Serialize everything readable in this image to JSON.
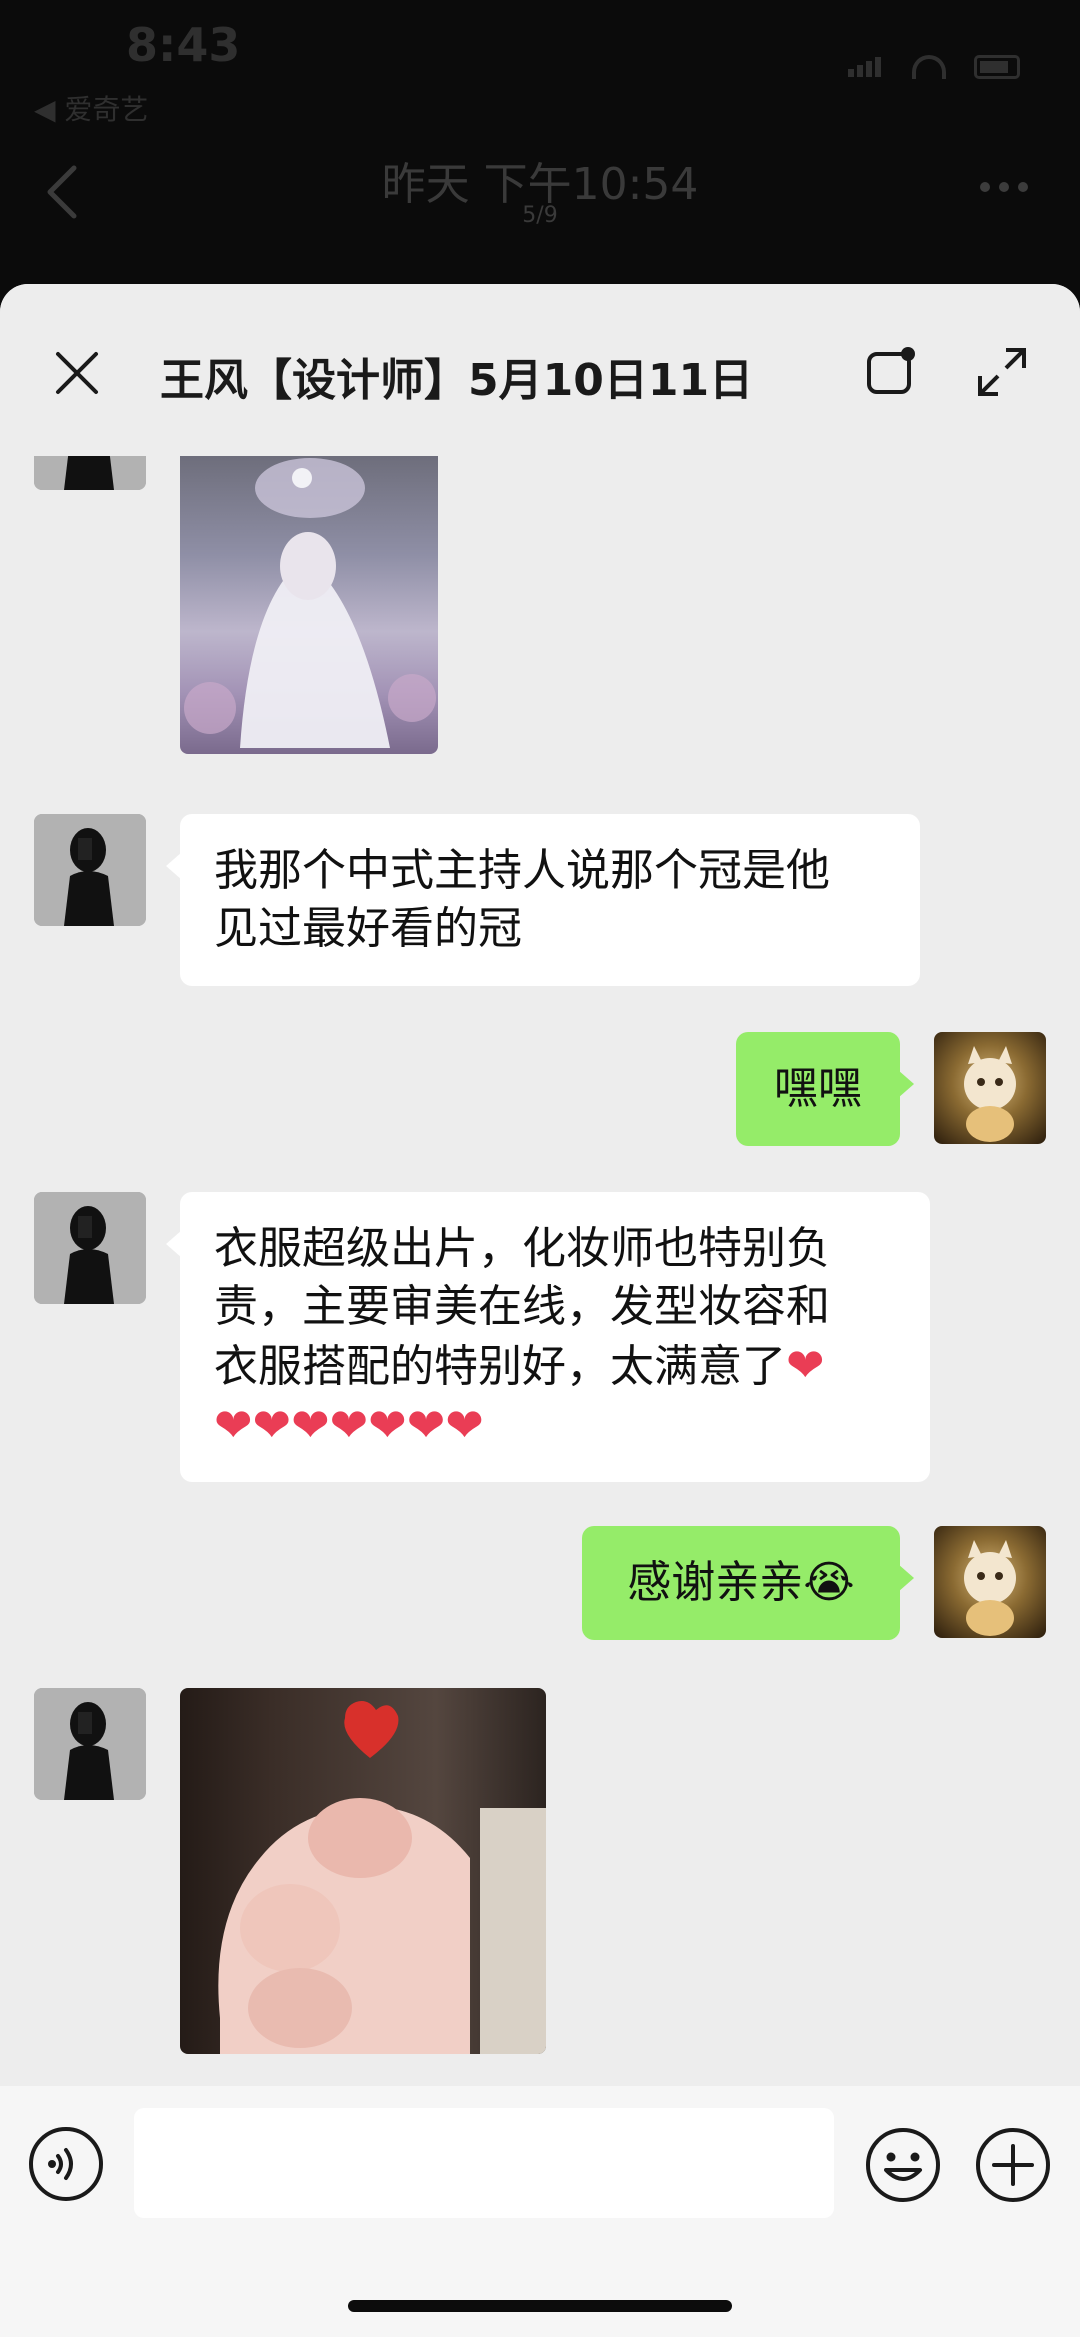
{
  "status_bar": {
    "time": "8:43",
    "back_app": "◀ 爱奇艺"
  },
  "viewer": {
    "date_title": "昨天 下午10:54",
    "counter": "5/9"
  },
  "chat": {
    "title": "王风【设计师】5月10日11日",
    "messages": [
      {
        "side": "left",
        "type": "image",
        "alt": "wedding photo"
      },
      {
        "side": "left",
        "type": "text",
        "lines": [
          "我那个中式主持人说那个冠是他",
          "见过最好看的冠"
        ]
      },
      {
        "side": "right",
        "type": "text",
        "lines": [
          "嘿嘿"
        ]
      },
      {
        "side": "left",
        "type": "text",
        "lines": [
          "衣服超级出片，化妆师也特别负",
          "责，主要审美在线，发型妆容和",
          "衣服搭配的特别好，太满意了"
        ],
        "hearts": "❤❤❤❤❤❤❤"
      },
      {
        "side": "right",
        "type": "text",
        "lines": [
          "感谢亲亲😭"
        ]
      },
      {
        "side": "left",
        "type": "image",
        "alt": "baby fist with heart"
      }
    ]
  },
  "colors": {
    "sheet_bg": "#ededed",
    "my_bubble": "#95ec69",
    "their_bubble": "#ffffff",
    "heart": "#ea3d55"
  },
  "icons": [
    "close-icon",
    "floating-window-icon",
    "expand-icon",
    "voice-icon",
    "emoji-icon",
    "plus-icon",
    "back-chevron-icon",
    "more-dots-icon"
  ]
}
